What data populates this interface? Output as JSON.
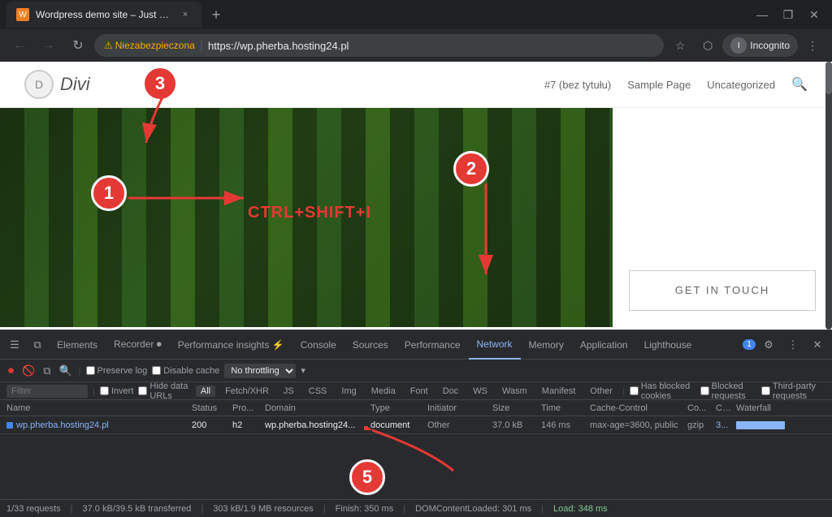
{
  "browser": {
    "tab": {
      "favicon": "W",
      "title": "Wordpress demo site – Just ano...",
      "close": "×"
    },
    "new_tab": "+",
    "window_controls": {
      "minimize": "—",
      "restore": "❐",
      "close": "✕"
    },
    "nav": {
      "back": "←",
      "forward": "→",
      "refresh": "↻",
      "security_warning": "Niezabezpieczona",
      "address": "https://wp.pherba.hosting24.pl",
      "bookmark": "☆",
      "extension": "⬡",
      "profile": "Incognito",
      "menu": "⋮"
    }
  },
  "website": {
    "logo_letter": "D",
    "logo_name": "Divi",
    "nav_items": [
      "#7 (bez tytułu)",
      "Sample Page",
      "Uncategorized"
    ],
    "get_in_touch": "GET IN TOUCH"
  },
  "annotations": {
    "num1": "1",
    "num2": "2",
    "num3": "3",
    "num5": "5",
    "ctrl_label": "CTRL+SHIFT+I"
  },
  "devtools": {
    "tabs": [
      {
        "label": "Elements",
        "active": false
      },
      {
        "label": "Recorder ⏺",
        "active": false
      },
      {
        "label": "Performance insights ⚡",
        "active": false
      },
      {
        "label": "Console",
        "active": false
      },
      {
        "label": "Sources",
        "active": false
      },
      {
        "label": "Performance",
        "active": false
      },
      {
        "label": "Network",
        "active": true
      },
      {
        "label": "Memory",
        "active": false
      },
      {
        "label": "Application",
        "active": false
      },
      {
        "label": "Lighthouse",
        "active": false
      }
    ],
    "badge": "1",
    "toolbar": {
      "record_icon": "⏺",
      "clear_icon": "🚫",
      "filter_icon": "⧉",
      "search_icon": "🔍",
      "preserve_log": "Preserve log",
      "disable_cache": "Disable cache",
      "no_throttling": "No throttling",
      "online_icon": "▾"
    },
    "filter": {
      "placeholder": "Filter"
    },
    "type_filters": [
      "Fetch/XHR",
      "JS",
      "CSS",
      "Img",
      "Media",
      "Font",
      "Doc",
      "WS",
      "Wasm",
      "Manifest",
      "Other"
    ],
    "checkboxes": {
      "invert": "Invert",
      "hide_data_urls": "Hide data URLs",
      "all": "All",
      "has_blocked_cookies": "Has blocked cookies",
      "blocked_requests": "Blocked requests",
      "third_party": "Third-party requests"
    },
    "table": {
      "headers": [
        "Name",
        "Status",
        "Pro...",
        "Domain",
        "Type",
        "Initiator",
        "Size",
        "Time",
        "Cache-Control",
        "Co...",
        "C...",
        "Waterfall"
      ],
      "rows": [
        {
          "name": "wp.pherba.hosting24.pl",
          "status": "200",
          "proto": "h2",
          "domain": "wp.pherba.hosting24...",
          "type": "document",
          "initiator": "Other",
          "size": "37.0 kB",
          "time": "146 ms",
          "cache": "max-age=3600, public",
          "co": "gzip",
          "c": "3...",
          "waterfall": true
        }
      ]
    },
    "status_bar": {
      "requests": "1/33 requests",
      "transferred": "37.0 kB/39.5 kB transferred",
      "resources": "303 kB/1.9 MB resources",
      "finish": "Finish: 350 ms",
      "dom_loaded": "DOMContentLoaded: 301 ms",
      "load": "Load: 348 ms"
    }
  }
}
